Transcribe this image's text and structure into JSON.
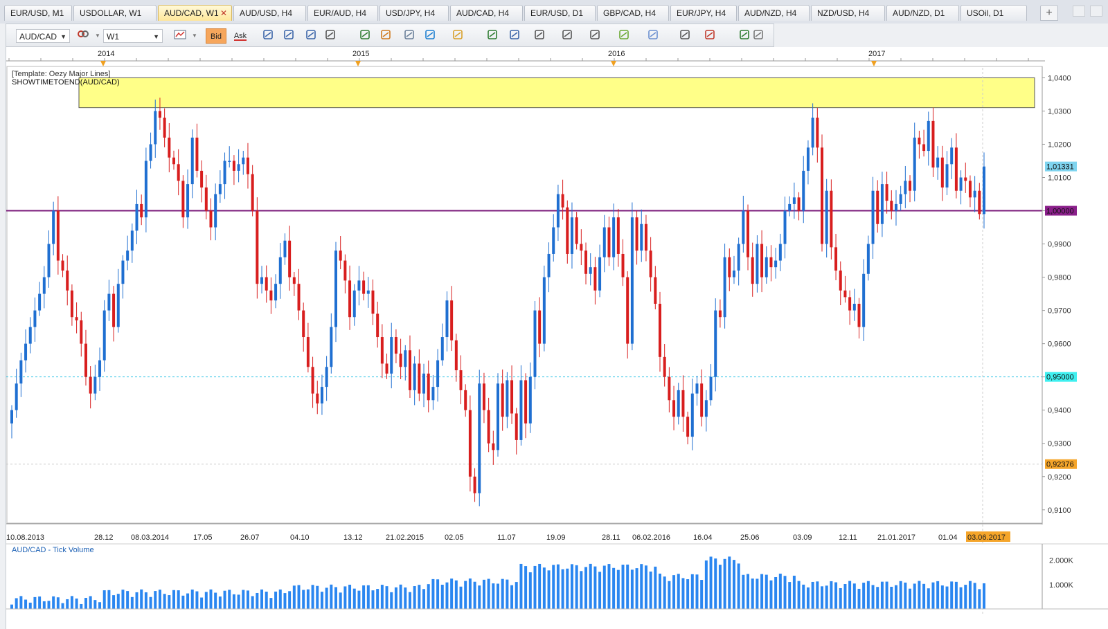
{
  "tabs": [
    {
      "label": "EUR/USD, M1",
      "active": false
    },
    {
      "label": "USDOLLAR, W1",
      "active": false
    },
    {
      "label": "AUD/CAD, W1",
      "active": true
    },
    {
      "label": "AUD/USD, H4",
      "active": false
    },
    {
      "label": "EUR/AUD, H4",
      "active": false
    },
    {
      "label": "USD/JPY, H4",
      "active": false
    },
    {
      "label": "AUD/CAD, H4",
      "active": false
    },
    {
      "label": "EUR/USD, D1",
      "active": false
    },
    {
      "label": "GBP/CAD, H4",
      "active": false
    },
    {
      "label": "EUR/JPY, H4",
      "active": false
    },
    {
      "label": "AUD/NZD, H4",
      "active": false
    },
    {
      "label": "NZD/USD, H4",
      "active": false
    },
    {
      "label": "AUD/NZD, D1",
      "active": false
    },
    {
      "label": "USOil, D1",
      "active": false
    }
  ],
  "tab_add_label": "+",
  "tab_close_glyph": "✕",
  "toolbar": {
    "symbol": "AUD/CAD",
    "timeframe": "W1",
    "bid_label": "Bid",
    "ask_label": "Ask",
    "icons": [
      "chart-type-icon",
      "crosshair-icon",
      "zoom-in-icon",
      "zoom-out-icon",
      "scroll-icon",
      "magnifier-icon",
      "fit-icon",
      "indicator-icon",
      "refresh-icon",
      "globe-icon",
      "ruler-icon",
      "picture-icon",
      "window-icon",
      "draw-line-icon",
      "lines-icon",
      "pen-icon",
      "brush-icon",
      "ellipse-icon",
      "text-icon",
      "eraser-icon",
      "tree-icon",
      "settings-icon"
    ]
  },
  "chart": {
    "template_label": "[Template: Oezy Major Lines]",
    "indicator_label": "SHOWTIMETOEND(AUD/CAD)",
    "years": [
      "2014",
      "2015",
      "2016",
      "2017"
    ],
    "date_labels": [
      "10.08.2013",
      "28.12",
      "08.03.2014",
      "17.05",
      "26.07",
      "04.10",
      "13.12",
      "21.02.2015",
      "02.05",
      "11.07",
      "19.09",
      "28.11",
      "06.02.2016",
      "16.04",
      "25.06",
      "03.09",
      "12.11",
      "21.01.2017",
      "01.04",
      "03.06.2017"
    ],
    "price_ticks": [
      "1,0400",
      "1,0300",
      "1,0200",
      "1,0100",
      "1,0000",
      "0,9900",
      "0,9800",
      "0,9700",
      "0,9600",
      "0,9500",
      "0,9400",
      "0,9300",
      "0,9200",
      "0,9100"
    ],
    "labels": {
      "current": "1,01331",
      "parity": "1,00000",
      "support": "0,95000",
      "cursor": "0,92376"
    },
    "colors": {
      "bull": "#1f6fd1",
      "bear": "#d81e1e",
      "zone": "#ffff88",
      "parity_line": "#7a1a7a",
      "current_bg": "#7fd4ef",
      "support_bg": "#3ff0f0",
      "cursor_bg": "#f5a52a",
      "date_highlight_bg": "#f5a52a",
      "volume": "#2a86f0"
    },
    "volume_label": "AUD/CAD - Tick Volume",
    "volume_ticks": [
      "2.000K",
      "1.000K"
    ]
  },
  "chart_data": {
    "type": "candlestick",
    "symbol": "AUD/CAD",
    "timeframe": "W1",
    "ylim": [
      0.906,
      1.043
    ],
    "support_resistance_zone": [
      1.031,
      1.04
    ],
    "horizontal_lines": [
      1.0,
      0.95,
      0.92376
    ],
    "current_price": 1.01331,
    "closes": [
      0.94,
      0.948,
      0.955,
      0.96,
      0.965,
      0.97,
      0.975,
      0.98,
      0.99,
      1.0,
      0.985,
      0.982,
      0.976,
      0.968,
      0.967,
      0.96,
      0.95,
      0.945,
      0.95,
      0.955,
      0.97,
      0.975,
      0.965,
      0.978,
      0.985,
      0.988,
      0.994,
      1.002,
      0.998,
      1.015,
      1.02,
      1.03,
      1.028,
      1.022,
      1.016,
      1.014,
      1.009,
      0.998,
      1.008,
      1.022,
      1.012,
      1.007,
      1.0,
      0.995,
      1.005,
      1.008,
      1.015,
      1.015,
      1.012,
      1.014,
      1.016,
      1.011,
      1.0,
      0.978,
      0.98,
      0.976,
      0.973,
      0.978,
      0.986,
      0.991,
      0.98,
      0.978,
      0.97,
      0.962,
      0.953,
      0.945,
      0.942,
      0.947,
      0.953,
      0.965,
      0.988,
      0.985,
      0.979,
      0.968,
      0.976,
      0.979,
      0.975,
      0.976,
      0.969,
      0.962,
      0.954,
      0.951,
      0.962,
      0.957,
      0.953,
      0.958,
      0.946,
      0.954,
      0.945,
      0.951,
      0.943,
      0.947,
      0.955,
      0.962,
      0.973,
      0.961,
      0.952,
      0.946,
      0.94,
      0.92,
      0.915,
      0.948,
      0.94,
      0.93,
      0.928,
      0.948,
      0.938,
      0.949,
      0.939,
      0.931,
      0.949,
      0.936,
      0.95,
      0.97,
      0.96,
      0.98,
      0.987,
      0.995,
      1.005,
      1.001,
      0.987,
      0.998,
      0.99,
      0.988,
      0.981,
      0.983,
      0.976,
      0.986,
      0.995,
      0.986,
      0.998,
      0.987,
      0.98,
      0.96,
      0.998,
      0.988,
      0.996,
      0.988,
      0.98,
      0.972,
      0.956,
      0.95,
      0.943,
      0.938,
      0.946,
      0.938,
      0.932,
      0.945,
      0.948,
      0.938,
      0.943,
      0.95,
      0.97,
      0.968,
      0.986,
      0.98,
      0.982,
      0.99,
      1.0,
      0.986,
      0.978,
      0.99,
      0.98,
      0.986,
      0.983,
      0.985,
      0.99,
      1.0,
      1.002,
      1.004,
      1.0,
      1.012,
      1.019,
      1.028,
      1.019,
      0.99,
      1.006,
      0.989,
      0.982,
      0.976,
      0.974,
      0.97,
      0.972,
      0.965,
      0.981,
      0.99,
      1.006,
      0.996,
      1.008,
      1.003,
      1.0,
      1.002,
      1.005,
      1.009,
      1.006,
      1.022,
      1.02,
      1.018,
      1.027,
      1.013,
      1.016,
      1.007,
      1.014,
      1.019,
      1.006,
      1.01,
      1.009,
      1.004,
      1.006,
      0.999,
      1.0133
    ],
    "volume_max": 2500
  }
}
